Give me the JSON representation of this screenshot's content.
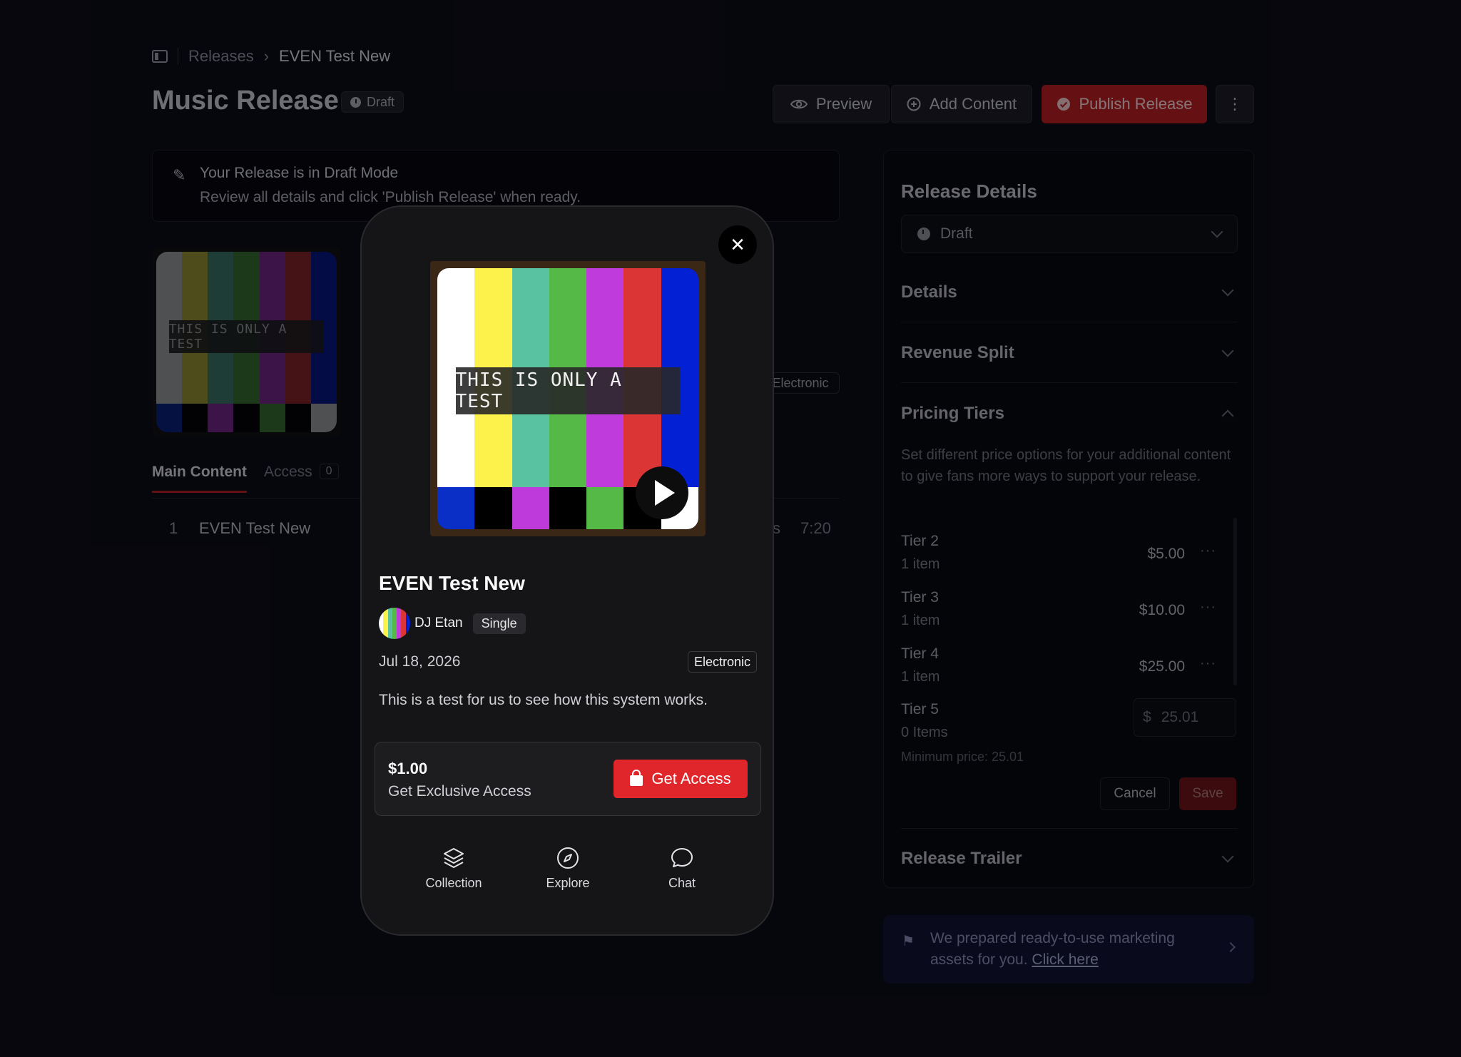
{
  "breadcrumb": {
    "parent": "Releases",
    "current": "EVEN Test New"
  },
  "page": {
    "title": "Music Release",
    "status_badge": "Draft"
  },
  "toolbar": {
    "preview": "Preview",
    "add_content": "Add Content",
    "publish": "Publish Release",
    "more": "⋮"
  },
  "draft_notice": {
    "title": "Your Release is in Draft Mode",
    "body": "Review all details and click 'Publish Release' when ready."
  },
  "cover": {
    "label": "THIS IS ONLY A TEST"
  },
  "background_genre": "Electronic",
  "tabs": {
    "main": "Main Content",
    "access": "Access",
    "access_count": "0"
  },
  "track": {
    "number": "1",
    "name": "EVEN Test New",
    "suffix": "s",
    "duration": "7:20"
  },
  "release_details": {
    "title": "Release Details",
    "status": "Draft",
    "sections": {
      "details": "Details",
      "revenue": "Revenue Split",
      "pricing": "Pricing Tiers",
      "trailer": "Release Trailer"
    },
    "pricing_description": "Set different price options for your additional content to give fans more ways to support your release.",
    "tiers": [
      {
        "name": "Tier 2",
        "items": "1 item",
        "price": "$5.00"
      },
      {
        "name": "Tier 3",
        "items": "1 item",
        "price": "$10.00"
      },
      {
        "name": "Tier 4",
        "items": "1 item",
        "price": "$25.00"
      }
    ],
    "new_tier": {
      "name": "Tier 5",
      "items": "0 Items",
      "currency": "$",
      "value": "25.01",
      "min_price": "Minimum price: 25.01"
    },
    "cancel": "Cancel",
    "save": "Save",
    "dots": "···"
  },
  "marketing": {
    "text": "We prepared ready-to-use marketing assets for you.",
    "link": "Click here"
  },
  "modal": {
    "title": "EVEN Test New",
    "artist": "DJ Etan",
    "type": "Single",
    "date": "Jul 18, 2026",
    "genre": "Electronic",
    "description": "This is a test for us to see how this system works.",
    "access_price": "$1.00",
    "access_label": "Get Exclusive Access",
    "get_access": "Get Access",
    "close": "✕",
    "nav": {
      "collection": "Collection",
      "explore": "Explore",
      "chat": "Chat"
    }
  },
  "colors": {
    "test_bars_top": [
      "#ffffff",
      "#fdf14c",
      "#58c2a1",
      "#54b947",
      "#c03bdc",
      "#dc3535",
      "#0420d4"
    ],
    "test_bars_bottom": [
      "#0a2fc7",
      "#000000",
      "#bf3adb",
      "#000000",
      "#54b947",
      "#000000",
      "#ffffff"
    ],
    "accent_red": "#e0262b"
  }
}
